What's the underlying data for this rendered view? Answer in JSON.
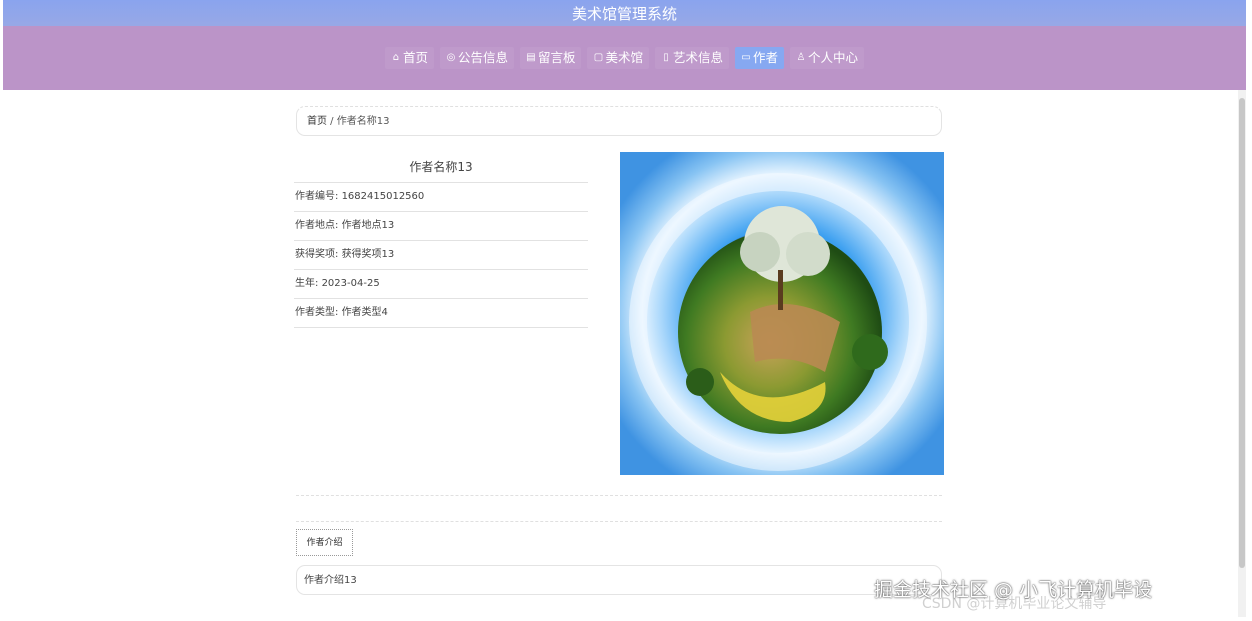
{
  "header": {
    "title": "美术馆管理系统"
  },
  "nav": {
    "items": [
      {
        "icon": "home-icon",
        "glyph": "⌂",
        "label": "首页",
        "active": false
      },
      {
        "icon": "announcement-icon",
        "glyph": "◎",
        "label": "公告信息",
        "active": false
      },
      {
        "icon": "message-icon",
        "glyph": "▤",
        "label": "留言板",
        "active": false
      },
      {
        "icon": "gallery-icon",
        "glyph": "▢",
        "label": "美术馆",
        "active": false
      },
      {
        "icon": "art-info-icon",
        "glyph": "▯",
        "label": "艺术信息",
        "active": false
      },
      {
        "icon": "author-icon",
        "glyph": "▭",
        "label": "作者",
        "active": true
      },
      {
        "icon": "user-icon",
        "glyph": "♙",
        "label": "个人中心",
        "active": false
      }
    ]
  },
  "breadcrumb": {
    "home": "首页",
    "separator": " / ",
    "current": "作者名称13"
  },
  "author": {
    "name": "作者名称13",
    "fields": [
      {
        "label": "作者编号",
        "value": "1682415012560"
      },
      {
        "label": "作者地点",
        "value": "作者地点13"
      },
      {
        "label": "获得奖项",
        "value": "获得奖项13"
      },
      {
        "label": "生年",
        "value": "2023-04-25"
      },
      {
        "label": "作者类型",
        "value": "作者类型4"
      }
    ]
  },
  "tabs": {
    "intro_label": "作者介绍"
  },
  "intro": {
    "text": "作者介绍13"
  },
  "watermark": {
    "main": "掘金技术社区 @ 小飞计算机毕设",
    "sub": "CSDN @计算机毕业论文辅导"
  },
  "colors": {
    "title_bar": "#8aa4ee",
    "nav_bar": "#bb94c8",
    "active_tab": "#86a8f1"
  }
}
